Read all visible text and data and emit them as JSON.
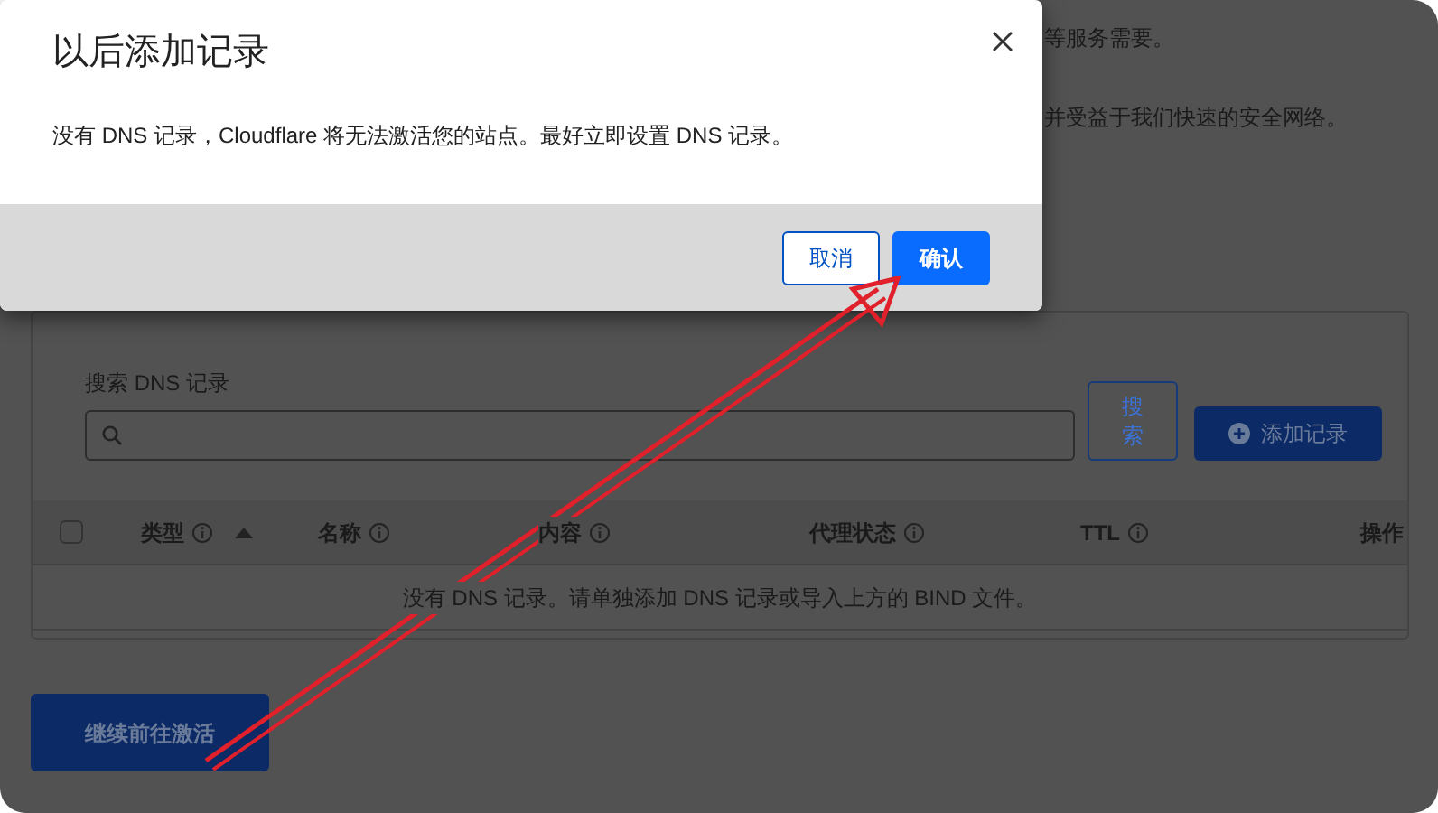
{
  "background": {
    "intro_lines": [
      "等服务需要。",
      "并受益于我们快速的安全网络。"
    ],
    "search": {
      "label": "搜索 DNS 记录"
    },
    "search_button": "搜索",
    "add_button": "添加记录",
    "table": {
      "select_all": {
        "checked": false
      },
      "columns": [
        {
          "label": "类型",
          "info": true,
          "sorted": true
        },
        {
          "label": "名称",
          "info": true,
          "sorted": false
        },
        {
          "label": "内容",
          "info": true,
          "sorted": false
        },
        {
          "label": "代理状态",
          "info": true,
          "sorted": false
        },
        {
          "label": "TTL",
          "info": true,
          "sorted": false
        },
        {
          "label": "操作",
          "info": false,
          "sorted": false
        }
      ],
      "empty_message": "没有 DNS 记录。请单独添加 DNS 记录或导入上方的 BIND 文件。"
    },
    "continue_button": "继续前往激活"
  },
  "dialog": {
    "title": "以后添加记录",
    "message": "没有 DNS 记录，Cloudflare 将无法激活您的站点。最好立即设置 DNS 记录。",
    "buttons": [
      {
        "label": "取消",
        "kind": "secondary"
      },
      {
        "label": "确认",
        "kind": "primary"
      }
    ]
  }
}
